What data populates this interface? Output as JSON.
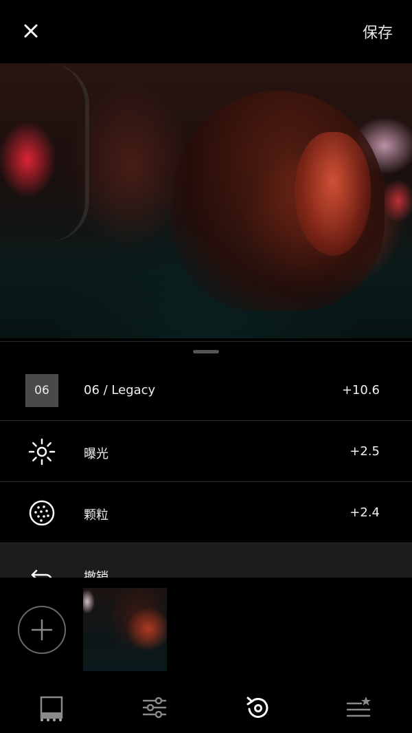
{
  "header": {
    "close_icon": "close-icon",
    "save_label": "保存"
  },
  "photo": {
    "description_icon": "photo-preview"
  },
  "adjustments": [
    {
      "badge": "06",
      "icon": "preset-badge",
      "label": "06 / Legacy",
      "value": "+10.6"
    },
    {
      "icon": "sun-icon",
      "label": "曝光",
      "value": "+2.5"
    },
    {
      "icon": "grain-icon",
      "label": "颗粒",
      "value": "+2.4"
    },
    {
      "icon": "undo-arrow-icon",
      "label": "撤销"
    }
  ],
  "bottom": {
    "add_icon": "plus-icon",
    "tabs": [
      {
        "icon": "presets-icon",
        "active": false
      },
      {
        "icon": "sliders-icon",
        "active": false
      },
      {
        "icon": "history-icon",
        "active": true
      },
      {
        "icon": "recipes-star-icon",
        "active": false
      }
    ]
  },
  "colors": {
    "background": "#000000",
    "row_divider": "#2e2e2e",
    "badge_bg": "#4a4a4a",
    "text": "#f0f0f0",
    "active_tab": "#ffffff",
    "inactive_tab": "#8a8a8a"
  }
}
